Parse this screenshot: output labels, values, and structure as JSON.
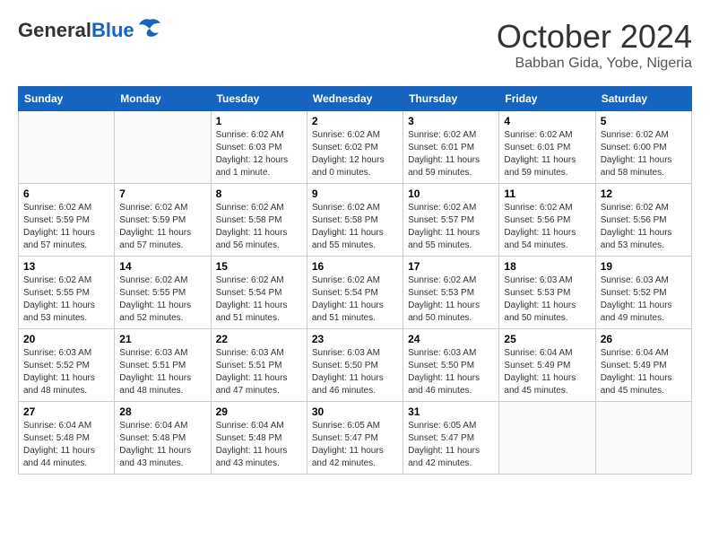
{
  "header": {
    "logo_general": "General",
    "logo_blue": "Blue",
    "month_title": "October 2024",
    "subtitle": "Babban Gida, Yobe, Nigeria"
  },
  "calendar": {
    "days_of_week": [
      "Sunday",
      "Monday",
      "Tuesday",
      "Wednesday",
      "Thursday",
      "Friday",
      "Saturday"
    ],
    "weeks": [
      [
        {
          "day": "",
          "detail": ""
        },
        {
          "day": "",
          "detail": ""
        },
        {
          "day": "1",
          "detail": "Sunrise: 6:02 AM\nSunset: 6:03 PM\nDaylight: 12 hours\nand 1 minute."
        },
        {
          "day": "2",
          "detail": "Sunrise: 6:02 AM\nSunset: 6:02 PM\nDaylight: 12 hours\nand 0 minutes."
        },
        {
          "day": "3",
          "detail": "Sunrise: 6:02 AM\nSunset: 6:01 PM\nDaylight: 11 hours\nand 59 minutes."
        },
        {
          "day": "4",
          "detail": "Sunrise: 6:02 AM\nSunset: 6:01 PM\nDaylight: 11 hours\nand 59 minutes."
        },
        {
          "day": "5",
          "detail": "Sunrise: 6:02 AM\nSunset: 6:00 PM\nDaylight: 11 hours\nand 58 minutes."
        }
      ],
      [
        {
          "day": "6",
          "detail": "Sunrise: 6:02 AM\nSunset: 5:59 PM\nDaylight: 11 hours\nand 57 minutes."
        },
        {
          "day": "7",
          "detail": "Sunrise: 6:02 AM\nSunset: 5:59 PM\nDaylight: 11 hours\nand 57 minutes."
        },
        {
          "day": "8",
          "detail": "Sunrise: 6:02 AM\nSunset: 5:58 PM\nDaylight: 11 hours\nand 56 minutes."
        },
        {
          "day": "9",
          "detail": "Sunrise: 6:02 AM\nSunset: 5:58 PM\nDaylight: 11 hours\nand 55 minutes."
        },
        {
          "day": "10",
          "detail": "Sunrise: 6:02 AM\nSunset: 5:57 PM\nDaylight: 11 hours\nand 55 minutes."
        },
        {
          "day": "11",
          "detail": "Sunrise: 6:02 AM\nSunset: 5:56 PM\nDaylight: 11 hours\nand 54 minutes."
        },
        {
          "day": "12",
          "detail": "Sunrise: 6:02 AM\nSunset: 5:56 PM\nDaylight: 11 hours\nand 53 minutes."
        }
      ],
      [
        {
          "day": "13",
          "detail": "Sunrise: 6:02 AM\nSunset: 5:55 PM\nDaylight: 11 hours\nand 53 minutes."
        },
        {
          "day": "14",
          "detail": "Sunrise: 6:02 AM\nSunset: 5:55 PM\nDaylight: 11 hours\nand 52 minutes."
        },
        {
          "day": "15",
          "detail": "Sunrise: 6:02 AM\nSunset: 5:54 PM\nDaylight: 11 hours\nand 51 minutes."
        },
        {
          "day": "16",
          "detail": "Sunrise: 6:02 AM\nSunset: 5:54 PM\nDaylight: 11 hours\nand 51 minutes."
        },
        {
          "day": "17",
          "detail": "Sunrise: 6:02 AM\nSunset: 5:53 PM\nDaylight: 11 hours\nand 50 minutes."
        },
        {
          "day": "18",
          "detail": "Sunrise: 6:03 AM\nSunset: 5:53 PM\nDaylight: 11 hours\nand 50 minutes."
        },
        {
          "day": "19",
          "detail": "Sunrise: 6:03 AM\nSunset: 5:52 PM\nDaylight: 11 hours\nand 49 minutes."
        }
      ],
      [
        {
          "day": "20",
          "detail": "Sunrise: 6:03 AM\nSunset: 5:52 PM\nDaylight: 11 hours\nand 48 minutes."
        },
        {
          "day": "21",
          "detail": "Sunrise: 6:03 AM\nSunset: 5:51 PM\nDaylight: 11 hours\nand 48 minutes."
        },
        {
          "day": "22",
          "detail": "Sunrise: 6:03 AM\nSunset: 5:51 PM\nDaylight: 11 hours\nand 47 minutes."
        },
        {
          "day": "23",
          "detail": "Sunrise: 6:03 AM\nSunset: 5:50 PM\nDaylight: 11 hours\nand 46 minutes."
        },
        {
          "day": "24",
          "detail": "Sunrise: 6:03 AM\nSunset: 5:50 PM\nDaylight: 11 hours\nand 46 minutes."
        },
        {
          "day": "25",
          "detail": "Sunrise: 6:04 AM\nSunset: 5:49 PM\nDaylight: 11 hours\nand 45 minutes."
        },
        {
          "day": "26",
          "detail": "Sunrise: 6:04 AM\nSunset: 5:49 PM\nDaylight: 11 hours\nand 45 minutes."
        }
      ],
      [
        {
          "day": "27",
          "detail": "Sunrise: 6:04 AM\nSunset: 5:48 PM\nDaylight: 11 hours\nand 44 minutes."
        },
        {
          "day": "28",
          "detail": "Sunrise: 6:04 AM\nSunset: 5:48 PM\nDaylight: 11 hours\nand 43 minutes."
        },
        {
          "day": "29",
          "detail": "Sunrise: 6:04 AM\nSunset: 5:48 PM\nDaylight: 11 hours\nand 43 minutes."
        },
        {
          "day": "30",
          "detail": "Sunrise: 6:05 AM\nSunset: 5:47 PM\nDaylight: 11 hours\nand 42 minutes."
        },
        {
          "day": "31",
          "detail": "Sunrise: 6:05 AM\nSunset: 5:47 PM\nDaylight: 11 hours\nand 42 minutes."
        },
        {
          "day": "",
          "detail": ""
        },
        {
          "day": "",
          "detail": ""
        }
      ]
    ]
  }
}
